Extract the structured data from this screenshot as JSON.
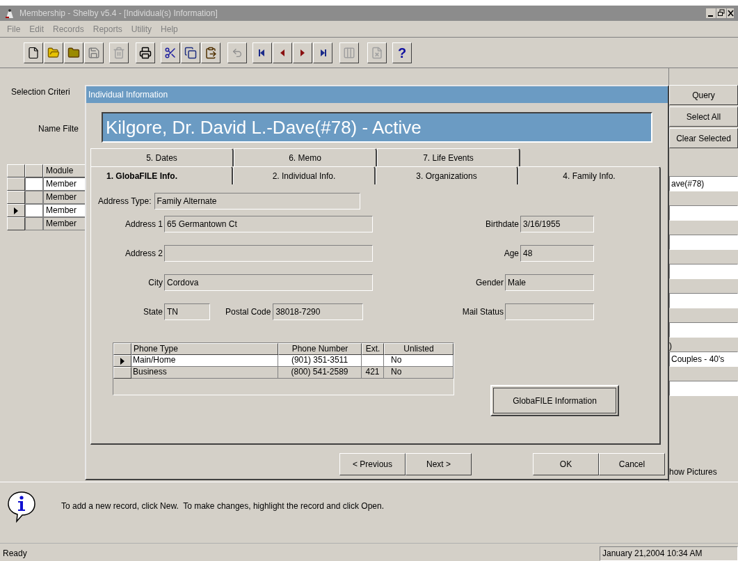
{
  "window": {
    "title": "Membership - Shelby v5.4 - [Individual(s) Information]"
  },
  "menu": [
    "File",
    "Edit",
    "Records",
    "Reports",
    "Utility",
    "Help"
  ],
  "toolbar": {
    "help_label": "?"
  },
  "background": {
    "selection_label": "Selection Criteri",
    "name_filter_label": "Name Filte",
    "grid": {
      "column": "Module",
      "rows": [
        {
          "cell": "Member",
          "current": false
        },
        {
          "cell": "Member",
          "current": false
        },
        {
          "cell": "Member",
          "current": true
        },
        {
          "cell": "Member",
          "current": false
        }
      ]
    },
    "buttons": [
      "Query",
      "Select All",
      "Clear Selected"
    ],
    "side_rows": [
      {
        "kind": "field",
        "text": "ave(#78)"
      },
      {
        "kind": "field"
      },
      {
        "kind": "field"
      },
      {
        "kind": "field"
      },
      {
        "kind": "field"
      },
      {
        "kind": "field"
      },
      {
        "kind": "label",
        "text": ")"
      },
      {
        "kind": "field",
        "text": "Couples - 40's"
      },
      {
        "kind": "field"
      },
      {
        "kind": "checkbox",
        "text": "how Pictures"
      }
    ]
  },
  "dialog": {
    "title": "Individual Information",
    "heading": "Kilgore, Dr. David L.-Dave(#78) - Active",
    "tabs_back": [
      {
        "label": "5. Dates",
        "selected": false
      },
      {
        "label": "6. Memo",
        "selected": false
      },
      {
        "label": "7. Life Events",
        "selected": false
      }
    ],
    "tabs_front": [
      {
        "label": "1. GlobaFILE Info.",
        "selected": true
      },
      {
        "label": "2. Individual Info.",
        "selected": false
      },
      {
        "label": "3. Organizations",
        "selected": false
      },
      {
        "label": "4. Family Info.",
        "selected": false
      }
    ],
    "address_type": {
      "label": "Address Type:",
      "value": "Family Alternate"
    },
    "left_fields": [
      {
        "label": "Address 1",
        "value": "65 Germantown Ct"
      },
      {
        "label": "Address 2"
      },
      {
        "label": "City",
        "value": "Cordova"
      }
    ],
    "state": {
      "label": "State",
      "value": "TN"
    },
    "postal_code": {
      "label": "Postal Code",
      "value": "38018-7290"
    },
    "right_fields": [
      {
        "label": "Birthdate",
        "value": "3/16/1955"
      },
      {
        "label": "Age",
        "value": "48"
      },
      {
        "label": "Gender",
        "value": "Male"
      },
      {
        "label": "Mail Status"
      }
    ],
    "phones": {
      "columns": [
        "Phone Type",
        "Phone Number",
        "Ext.",
        "Unlisted"
      ],
      "rows": [
        {
          "cells": [
            "Main/Home",
            "(901) 351-3511",
            "",
            "No"
          ],
          "selected": true
        },
        {
          "cells": [
            "Business",
            "(800) 541-2589",
            "421",
            "No"
          ],
          "selected": false
        }
      ]
    },
    "globafile_button": "GlobaFILE Information",
    "nav_buttons": [
      "< Previous",
      "Next >"
    ],
    "buttons": [
      "OK",
      "Cancel"
    ]
  },
  "hint": "To add a new record, click New.  To make changes, highlight the record and click Open.",
  "status_bar": {
    "state": "Ready",
    "datetime": "January 21,2004 10:34 AM"
  }
}
